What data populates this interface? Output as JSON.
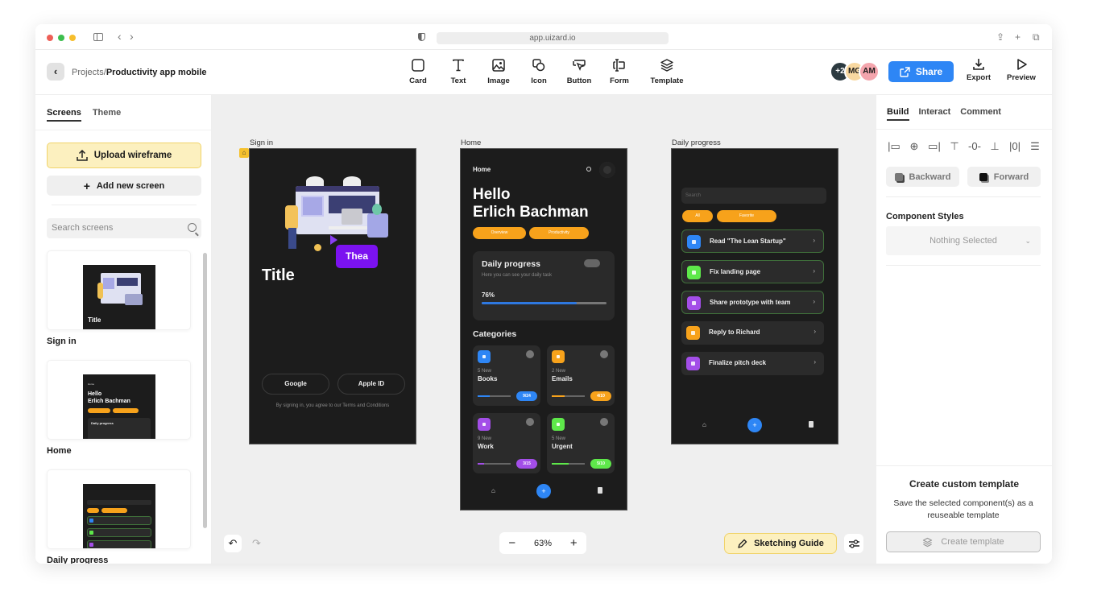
{
  "browser": {
    "url": "app.uizard.io",
    "traffic_colors": [
      "#ee5f57",
      "#3dbe4e",
      "#f6be2c"
    ],
    "back_glyph": "‹",
    "forward_glyph": "›",
    "right_icons": [
      "share-icon",
      "new-tab-icon",
      "tabs-icon"
    ],
    "share_glyph": "⇪",
    "newtab_glyph": "+",
    "tabs_glyph": "⧉"
  },
  "header": {
    "back_glyph": "‹",
    "breadcrumb_parent": "Projects",
    "breadcrumb_sep": "/",
    "breadcrumb_current": "Productivity app mobile",
    "tools": [
      {
        "label": "Card",
        "icon": "card-icon"
      },
      {
        "label": "Text",
        "icon": "text-icon"
      },
      {
        "label": "Image",
        "icon": "image-icon"
      },
      {
        "label": "Icon",
        "icon": "shapes-icon"
      },
      {
        "label": "Button",
        "icon": "button-icon"
      },
      {
        "label": "Form",
        "icon": "form-icon"
      },
      {
        "label": "Template",
        "icon": "layers-icon"
      }
    ],
    "avatars": [
      {
        "text": "+2",
        "bg": "#2c3a40",
        "fg": "#ffffff"
      },
      {
        "text": "MG",
        "bg": "#f8d8a0",
        "fg": "#222222"
      },
      {
        "text": "AM",
        "bg": "#f4a5ad",
        "fg": "#222222"
      }
    ],
    "share_label": "Share",
    "share_color": "#2e86f5",
    "export_label": "Export",
    "preview_label": "Preview"
  },
  "left_panel": {
    "tabs": [
      {
        "label": "Screens",
        "active": true
      },
      {
        "label": "Theme",
        "active": false
      }
    ],
    "upload_label": "Upload wireframe",
    "add_screen_label": "Add new screen",
    "search_placeholder": "Search screens",
    "screens": [
      {
        "name": "Sign in"
      },
      {
        "name": "Home"
      },
      {
        "name": "Daily progress"
      }
    ],
    "thumb_signin_title": "Title",
    "thumb_home_hello": "Hello",
    "thumb_home_name": "Erlich Bachman",
    "thumb_home_dp": "Daily progress"
  },
  "canvas": {
    "zoom_level": "63%",
    "zoom_minus": "−",
    "zoom_plus": "+",
    "undo_glyph": "↶",
    "redo_glyph": "↷",
    "sketching_guide_label": "Sketching Guide",
    "frames": {
      "signin": {
        "label": "Sign in",
        "illustration_tag": "Thea",
        "title": "Title",
        "google_label": "Google",
        "apple_label": "Apple ID",
        "terms": "By signing in, you agree to our Terms and Conditions"
      },
      "home": {
        "label": "Home",
        "nav_title": "Home",
        "hello": "Hello",
        "name": "Erlich Bachman",
        "pills": [
          "Overview",
          "Productivity"
        ],
        "dp_title": "Daily progress",
        "dp_sub": "Here you can see your daily task",
        "dp_percent_label": "76%",
        "dp_progress": 0.76,
        "categories_title": "Categories",
        "categories": [
          {
            "new": "5 New",
            "name": "Books",
            "badge": "9/24",
            "progress": 0.375,
            "color": "#2e86f5"
          },
          {
            "new": "2 New",
            "name": "Emails",
            "badge": "4/10",
            "progress": 0.4,
            "color": "#f7a21b"
          },
          {
            "new": "9 New",
            "name": "Work",
            "badge": "3/15",
            "progress": 0.2,
            "color": "#a34ee8"
          },
          {
            "new": "5 New",
            "name": "Urgent",
            "badge": "5/10",
            "progress": 0.5,
            "color": "#5ee84a"
          }
        ]
      },
      "daily": {
        "label": "Daily progress",
        "search_placeholder": "Search",
        "pills": [
          "All",
          "Favorite"
        ],
        "tasks": [
          {
            "text": "Read \"The Lean Startup\"",
            "color": "#2e86f5",
            "highlighted": true
          },
          {
            "text": "Fix landing page",
            "color": "#5ee84a",
            "highlighted": true
          },
          {
            "text": "Share prototype with team",
            "color": "#a34ee8",
            "highlighted": true
          },
          {
            "text": "Reply to Richard",
            "color": "#f7a21b",
            "highlighted": false
          },
          {
            "text": "Finalize pitch deck",
            "color": "#a34ee8",
            "highlighted": false
          }
        ]
      }
    }
  },
  "right_panel": {
    "tabs": [
      {
        "label": "Build",
        "active": true
      },
      {
        "label": "Interact",
        "active": false
      },
      {
        "label": "Comment",
        "active": false
      }
    ],
    "align_tools": [
      "align-left",
      "align-center-h",
      "align-right",
      "align-top",
      "align-center-v",
      "align-bottom",
      "distribute-h",
      "distribute-v"
    ],
    "backward_label": "Backward",
    "forward_label": "Forward",
    "component_styles_title": "Component Styles",
    "component_styles_value": "Nothing Selected",
    "custom_template_title": "Create custom template",
    "custom_template_desc": "Save the selected component(s) as a reuseable template",
    "create_template_label": "Create template"
  }
}
